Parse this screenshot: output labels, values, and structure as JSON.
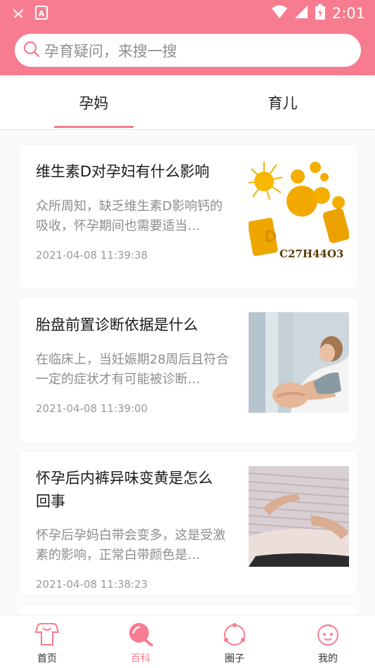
{
  "status_bar": {
    "time": "2:01"
  },
  "search": {
    "placeholder": "孕育疑问，来搜一搜"
  },
  "tabs": [
    {
      "label": "孕妈",
      "active": true
    },
    {
      "label": "育儿",
      "active": false
    }
  ],
  "articles": [
    {
      "title": "维生素D对孕妇有什么影响",
      "summary": "众所周知，缺乏维生素D影响钙的吸收，怀孕期间也需要适当…",
      "time": "2021-04-08 11:39:38",
      "image_text": "C27H44O3"
    },
    {
      "title": "胎盘前置诊断依据是什么",
      "summary": "在临床上，当妊娠期28周后且符合一定的症状才有可能被诊断…",
      "time": "2021-04-08 11:39:00"
    },
    {
      "title": "怀孕后内裤异味变黄是怎么回事",
      "summary": "怀孕后孕妈白带会变多，这是受激素的影响，正常白带颜色是…",
      "time": "2021-04-08 11:38:23"
    }
  ],
  "bottom_nav": [
    {
      "label": "首页",
      "icon": "home-icon",
      "active": false
    },
    {
      "label": "百科",
      "icon": "search-icon",
      "active": true
    },
    {
      "label": "圈子",
      "icon": "circle-icon",
      "active": false
    },
    {
      "label": "我的",
      "icon": "baby-face-icon",
      "active": false
    }
  ],
  "colors": {
    "accent": "#f77c8f"
  }
}
